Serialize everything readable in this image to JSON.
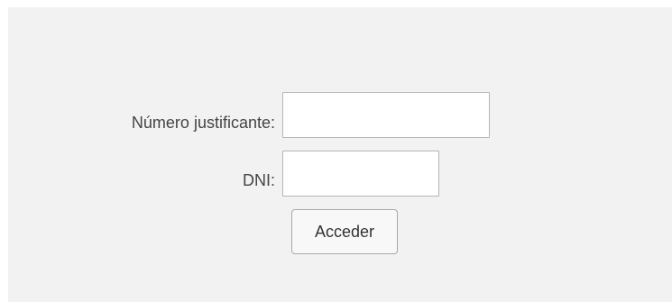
{
  "form": {
    "justificante_label": "Número justificante:",
    "justificante_value": "",
    "dni_label": "DNI:",
    "dni_value": "",
    "submit_label": "Acceder"
  }
}
